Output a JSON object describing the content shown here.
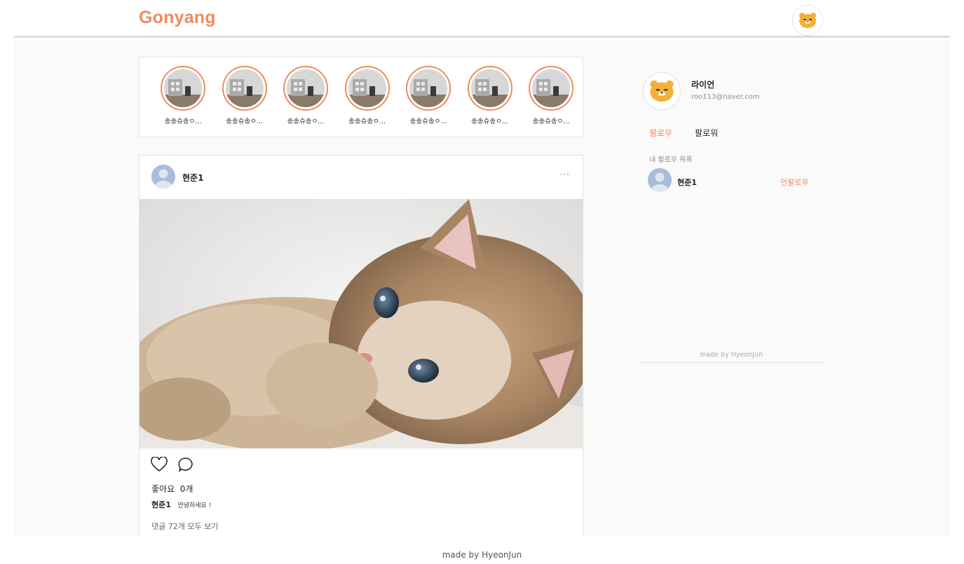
{
  "header": {
    "logo": "Gonyang",
    "avatar_icon": "ryan-bear-icon"
  },
  "stories": [
    {
      "name": "송송슈송ㅇ..."
    },
    {
      "name": "송송슈송ㅇ..."
    },
    {
      "name": "송송슈송ㅇ..."
    },
    {
      "name": "송송슈송ㅇ..."
    },
    {
      "name": "송송슈송ㅇ..."
    },
    {
      "name": "송송슈송ㅇ..."
    },
    {
      "name": "송송슈송ㅇ..."
    }
  ],
  "post": {
    "username": "현준1",
    "more_label": "···",
    "likes_label": "좋아요",
    "likes_count": "0개",
    "caption_user": "현준1",
    "caption_text": "안녕하세요 !",
    "comments_link": "댓글 72개 모두 보기"
  },
  "sidebar": {
    "name": "라이언",
    "email": "roo113@naver.com",
    "tab_follow": "팔로우",
    "tab_follower": "팔로워",
    "list_title": "내 팔로우 목록",
    "follow_list": [
      {
        "name": "현준1",
        "action": "언팔로우"
      }
    ],
    "footer": "made by HyeonJun"
  },
  "footer": "made by HyeonJun",
  "colors": {
    "accent": "#ef8c5e",
    "background": "#fafafa",
    "border": "#e2e2e2"
  }
}
